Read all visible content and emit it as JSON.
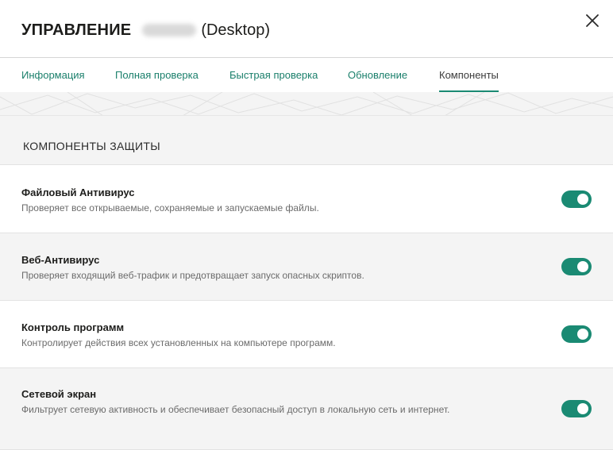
{
  "header": {
    "title": "УПРАВЛЕНИЕ",
    "title_suffix": "(Desktop)"
  },
  "tabs": [
    {
      "label": "Информация",
      "active": false
    },
    {
      "label": "Полная проверка",
      "active": false
    },
    {
      "label": "Быстрая проверка",
      "active": false
    },
    {
      "label": "Обновление",
      "active": false
    },
    {
      "label": "Компоненты",
      "active": true
    }
  ],
  "section": {
    "title": "КОМПОНЕНТЫ ЗАЩИТЫ"
  },
  "components": [
    {
      "name": "Файловый Антивирус",
      "description": "Проверяет все открываемые, сохраняемые и запускаемые файлы.",
      "enabled": true
    },
    {
      "name": "Веб-Антивирус",
      "description": "Проверяет входящий веб-трафик и предотвращает запуск опасных скриптов.",
      "enabled": true
    },
    {
      "name": "Контроль программ",
      "description": "Контролирует действия всех установленных на компьютере программ.",
      "enabled": true
    },
    {
      "name": "Сетевой экран",
      "description": "Фильтрует сетевую активность и обеспечивает безопасный доступ в локальную сеть и интернет.",
      "enabled": true
    }
  ],
  "colors": {
    "accent": "#1a8a73",
    "tab_text": "#1a7f6b",
    "band_background": "#f4f4f4"
  },
  "icons": {
    "close": "close-icon"
  }
}
